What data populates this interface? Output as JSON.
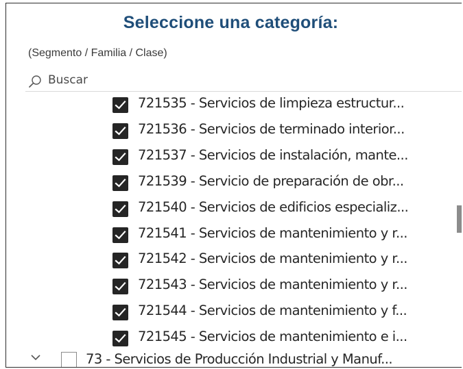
{
  "slicer": {
    "title": "Seleccione una categoría:",
    "subtitle": "(Segmento / Familia / Clase)",
    "search": {
      "placeholder": "Buscar",
      "value": ""
    },
    "items": [
      {
        "label": "721535 - Servicios de limpieza estructur...",
        "checked": true
      },
      {
        "label": "721536 - Servicios de terminado interior...",
        "checked": true
      },
      {
        "label": "721537 - Servicios de instalación, mante...",
        "checked": true
      },
      {
        "label": "721539 - Servicio de preparación de obr...",
        "checked": true
      },
      {
        "label": "721540 - Servicios de edificios especializ...",
        "checked": true
      },
      {
        "label": "721541 - Servicios de mantenimiento y r...",
        "checked": true
      },
      {
        "label": "721542 - Servicios de mantenimiento y r...",
        "checked": true
      },
      {
        "label": "721543 - Servicios de mantenimiento y r...",
        "checked": true
      },
      {
        "label": "721544 - Servicios de mantenimiento y f...",
        "checked": true
      },
      {
        "label": "721545 - Servicios de mantenimiento e i...",
        "checked": true
      }
    ],
    "partial_item": {
      "label": "73 - Servicios de Producción Industrial y Manuf...",
      "checked": false
    },
    "icons": {
      "search": "search-icon",
      "checkbox": "checkmark-icon",
      "expand": "chevron-down-icon"
    },
    "colors": {
      "title": "#1f4e79",
      "checkbox_fill": "#252525"
    }
  }
}
